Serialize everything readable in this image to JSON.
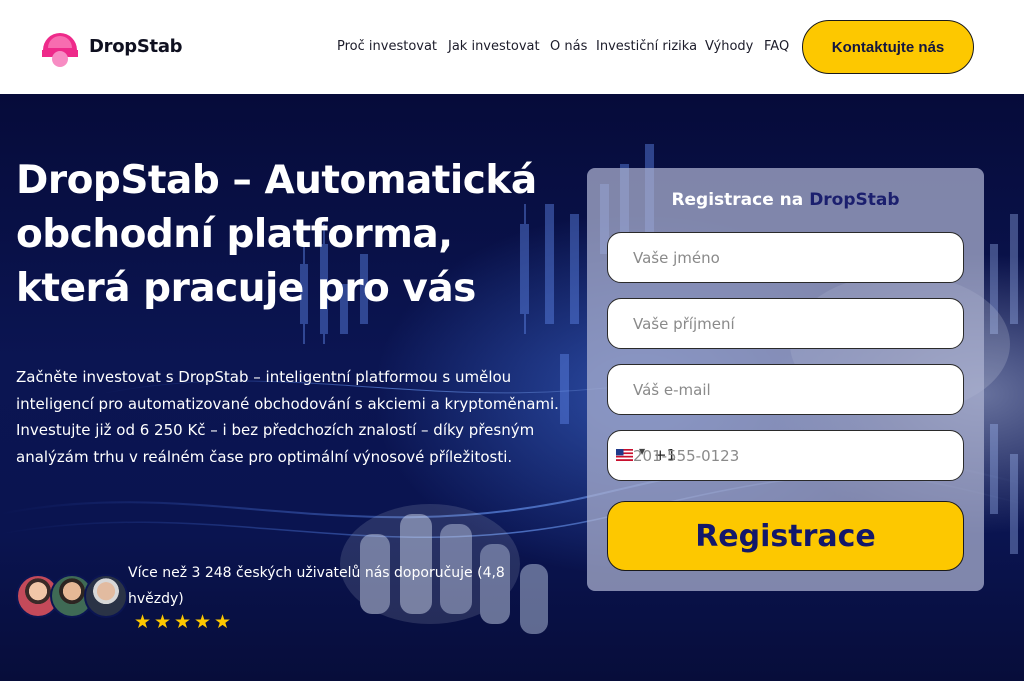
{
  "header": {
    "logo_text": "DropStab",
    "nav": [
      "Proč investovat",
      "Jak investovat",
      "O nás",
      "Investiční rizika",
      "Výhody",
      "FAQ"
    ],
    "contact_label": "Kontaktujte nás"
  },
  "hero": {
    "title": "DropStab – Automatická obchodní platforma, která pracuje pro vás",
    "description": "Začněte investovat s DropStab – inteligentní platformou s umělou inteligencí pro automatizované obchodování s akciemi a kryptoměnami. Investujte již od 6 250 Kč – i bez předchozích znalostí – díky přesným analýzám trhu v reálném čase pro optimální výnosové příležitosti.",
    "recommendation": "Více než 3 248 českých uživatelů nás doporučuje (4,8 hvězdy)",
    "rating_stars": 5
  },
  "form": {
    "title_prefix": "Registrace na",
    "title_brand": "DropStab",
    "first_name_placeholder": "Vaše jméno",
    "last_name_placeholder": "Vaše příjmení",
    "email_placeholder": "Váš e-mail",
    "phone_code": "+1",
    "phone_placeholder": "201-555-0123",
    "submit_label": "Registrace"
  },
  "colors": {
    "accent": "#fdc800",
    "brand_dark": "#13186a",
    "logo_pink": "#ee2a8a"
  }
}
